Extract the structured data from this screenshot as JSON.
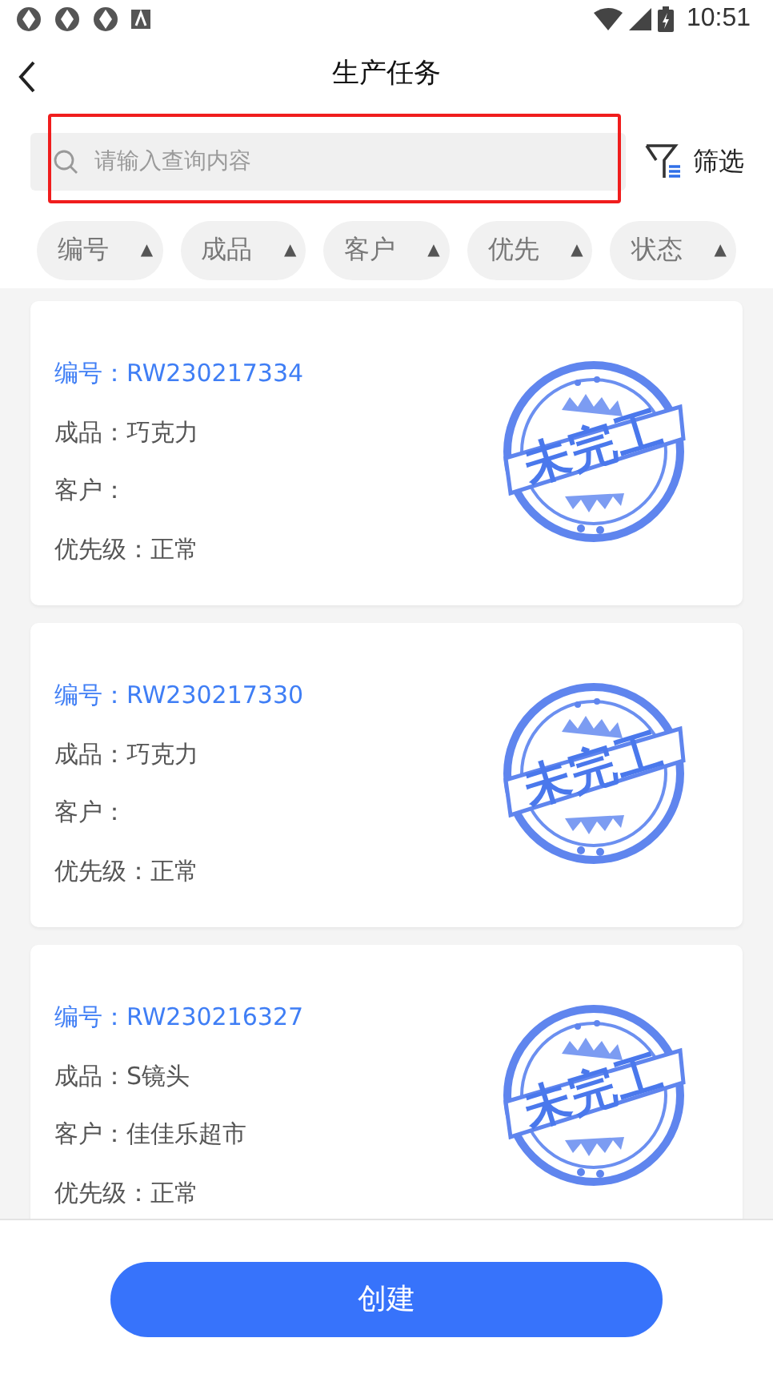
{
  "status_bar": {
    "time": "10:51"
  },
  "header": {
    "title": "生产任务"
  },
  "search": {
    "placeholder": "请输入查询内容",
    "highlighted": true
  },
  "filter_button": {
    "label": "筛选"
  },
  "sort_chips": [
    {
      "label": "编号",
      "arrow": "▲"
    },
    {
      "label": "成品",
      "arrow": "▲"
    },
    {
      "label": "客户",
      "arrow": "▲"
    },
    {
      "label": "优先",
      "arrow": "▲"
    },
    {
      "label": "状态",
      "arrow": "▲"
    }
  ],
  "tasks": [
    {
      "number": "编号：RW230217334",
      "product": "成品：巧克力",
      "customer": "客户：",
      "priority": "优先级：正常",
      "stamp": "未完工"
    },
    {
      "number": "编号：RW230217330",
      "product": "成品：巧克力",
      "customer": "客户：",
      "priority": "优先级：正常",
      "stamp": "未完工"
    },
    {
      "number": "编号：RW230216327",
      "product": "成品：S镜头",
      "customer": "客户：佳佳乐超市",
      "priority": "优先级：正常",
      "stamp": "未完工"
    }
  ],
  "create_button": {
    "label": "创建"
  }
}
